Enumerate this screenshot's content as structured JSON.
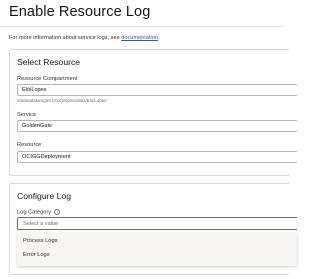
{
  "page": {
    "title": "Enable Resource Log",
    "info_prefix": "For more information about service logs, see ",
    "info_link": "documentation",
    "info_suffix": "."
  },
  "select_resource": {
    "heading": "Select Resource",
    "compartment_label": "Resource Compartment",
    "compartment_value": "EloiLopes",
    "compartment_path": "oraseadatamgmt (root)/Specialists/EloiLopes",
    "service_label": "Service",
    "service_value": "GoldenGate",
    "resource_label": "Resource",
    "resource_value": "OCIGGDeployment"
  },
  "configure_log": {
    "heading": "Configure Log",
    "category_label": "Log Category",
    "info_icon_glyph": "i",
    "category_placeholder": "Select a value",
    "options": [
      "Process Logs",
      "Error Logs"
    ]
  },
  "colors": {
    "link": "#2d5d9b",
    "panel_border": "#dcd9d5",
    "dropdown_bg": "#f6f5f4"
  }
}
